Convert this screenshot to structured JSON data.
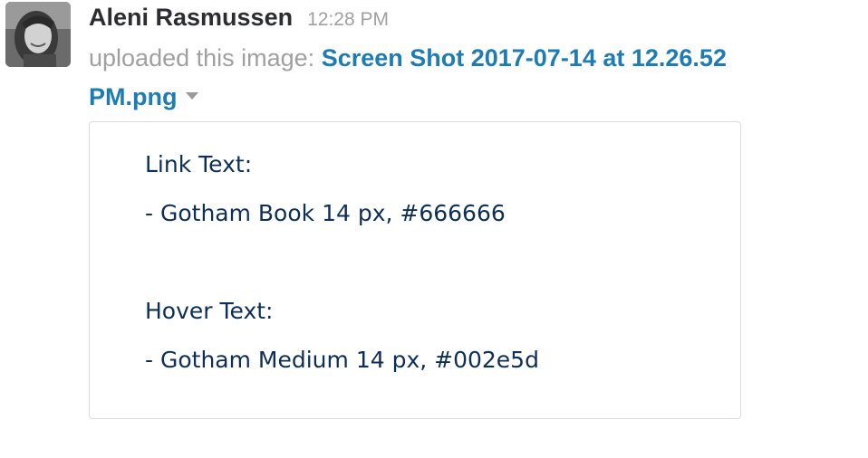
{
  "message": {
    "author": "Aleni Rasmussen",
    "time": "12:28 PM",
    "action_text": "uploaded this image:",
    "file_name": "Screen Shot 2017-07-14 at 12.26.52 PM.png",
    "avatar_icon": "user-avatar-photo"
  },
  "image_preview": {
    "lines": [
      "Link Text:",
      "- Gotham Book 14 px, #666666",
      "Hover Text:",
      "- Gotham Medium 14 px, #002e5d"
    ],
    "text_color": "#0d2f57"
  },
  "colors": {
    "link": "#1d7cb4",
    "author": "#2c2d30",
    "muted": "#a0a0a2"
  }
}
